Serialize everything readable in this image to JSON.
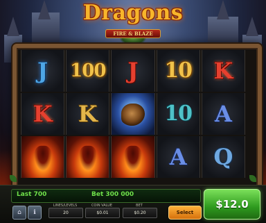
{
  "game": {
    "title": "Dragons",
    "subtitle": "FIRE & BLAZE"
  },
  "reels": [
    [
      "J",
      "100",
      "J",
      "10",
      "K"
    ],
    [
      "K",
      "K",
      "WILD",
      "10",
      "A"
    ],
    [
      "FIRE",
      "FIRE",
      "FIRE",
      "A",
      "Q"
    ]
  ],
  "panel": {
    "last_win": "Last 700",
    "bet_info": "Bet 300 000",
    "controls": [
      {
        "label": "LINES/LEVELS",
        "value": "20"
      },
      {
        "label": "COIN VALUE",
        "value": "$0.01"
      },
      {
        "label": "BET",
        "value": "$0.20"
      }
    ],
    "orange_button": "Select",
    "spin_button": "$12.0"
  },
  "colors": {
    "spin_green": "#2e9a1e",
    "gold_title": "#f7b52b",
    "frame_wood": "#7a5532"
  }
}
